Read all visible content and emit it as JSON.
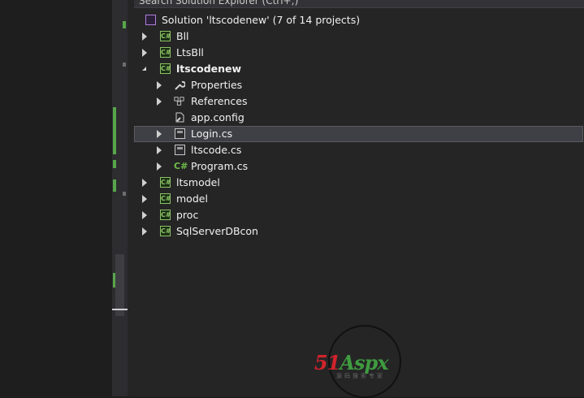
{
  "search": {
    "placeholder": "Search Solution Explorer (Ctrl+;)"
  },
  "solution": {
    "label": "Solution 'ltscodenew' (7 of 14 projects)"
  },
  "tree": {
    "items": [
      {
        "label": "Bll"
      },
      {
        "label": "LtsBll"
      },
      {
        "label": "ltscodenew"
      },
      {
        "label": "Properties"
      },
      {
        "label": "References"
      },
      {
        "label": "app.config"
      },
      {
        "label": "Login.cs"
      },
      {
        "label": "ltscode.cs"
      },
      {
        "label": "Program.cs"
      },
      {
        "label": "ltsmodel"
      },
      {
        "label": "model"
      },
      {
        "label": "proc"
      },
      {
        "label": "SqlServerDBcon"
      }
    ]
  },
  "icons": {
    "csproj_badge": "C#",
    "csharp_file": "C#"
  },
  "watermark": {
    "brand_red": "51",
    "brand_text": "Aspx",
    "sub": "源码搜索专家"
  },
  "colors": {
    "accent_green": "#57a64a",
    "selection": "#3f3f46",
    "watermark_red": "#d2232a",
    "watermark_green": "#3f9b3f"
  }
}
